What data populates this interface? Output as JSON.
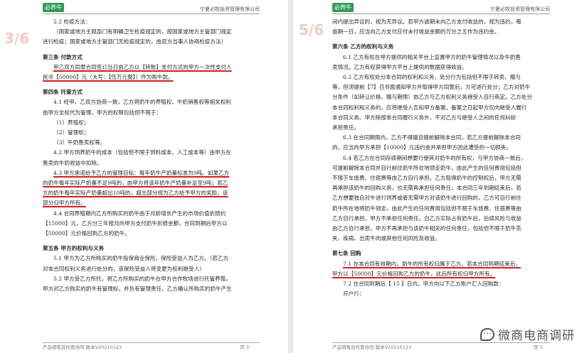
{
  "header": {
    "logo_text": "必养牛",
    "company": "宁夏必牧投资管理有限公司"
  },
  "left_page": {
    "page_marker": "3/6",
    "lines": [
      "2.2 检疫方法：",
      "（国家或地方主观部门有明确卫生检疫规定的，按国家或地方主管部门规定",
      "进行检疫；国家或地方主管部门无检疫规定的，由双方当事人协商检疫方法）",
      "第三条 付款方式",
      "甲乙双方同意合同签订当日由乙方以【转账】支付方式向甲方一次性支付人",
      "民币【50000】元（大写：【伍万元整】）作为购牛款。",
      "第四条 托管方式",
      "4.1 经甲、乙双方协商一致，乙方将奶牛的养殖权、牛奶销售权等相关权利",
      "由甲方全权代为管理，甲方的权限包括但不限于：",
      "（1）养殖权；",
      "（2）管理权；",
      "（3）牛奶售卖权等。",
      "4.2 甲方饲养奶牛的成本（包括但不限于饲料成本、人工成本等）由甲方在",
      "售卖的牛奶收益中扣除。",
      "4.3 甲方承诺给予乙方的管理目标：每年奶牛产奶量标准为9吨。如果乙方",
      "的奶牛每年实际产奶量不足9吨的，由甲方将该年奶牛产奶量补足至9吨；若乙",
      "方的奶牛每年实际产奶量超出10吨的，超出部分视为乙方给予甲方的奖励，该",
      "部分归甲方所有。",
      "4.4 合同养殖期内乙方所购买的奶牛由于月龄增长产生的市场价值折损约",
      "【15000】元，乙方分三年按月向甲方支付奶牛折损金额，合同到期后甲方以",
      "【50000】元价格回购乙方的奶牛。",
      "第五条 甲方的权利与义务",
      "5.1 甲方为乙方所购买的奶牛投保商业保险，保险受益人为乙方。（若乙方",
      "对本合同权利义务进行处分的，该保险受益人将变更为权利继受人）",
      "5.2 甲方受乙方所托，将乙方所购买的奶牛在甲方合作牧场进行托管养殖，",
      "甲方对乙方购买的奶牛有管理权，并负有管理责任，乙方确认所购买的奶牛产生"
    ],
    "footer_left": "产品销售及托管合同 版本V20210123",
    "footer_right": "页 3"
  },
  "right_page": {
    "page_marker": "5/6",
    "lines": [
      "间内提出异议的，视为无异议。若甲方逾期未向乙方支付收益的，视为违约，每",
      "逾期一日，应当向乙方支付应付未付收益金额的万分之五作为违约金。",
      "第六条 乙方的权利与义务",
      "6.1 乙方有权在甲方提供的相关平台上监督甲方的奶牛管理情况以及牛奶售",
      "卖情况。乙方有权获得甲方平台上提供的数据获得收益。",
      "6.2 乙方有权处分本合同的权利和义务，处分行为包括但不限于转卖、赠与",
      "等，但须提前【7】日书面通知甲方并取得甲方同意后，方可进行处分；乙方对奶牛",
      "分条件（如转让价格、赠与期限）由乙方与乙方权利义务继受人自行商定。乙方处分",
      "本合同权利和义务的，应将继受人告知甲方备案。备案之日起甲方仅向继受人履行",
      "本合同义务。甲方除按本合同履行义务外，不对乙方与继受人之间的任何纠纷",
      "承担责任。",
      "6.3 在合同期限内，乙方不得擅自提前解除本合同，若乙方提前解除本合同",
      "的，应当向甲方承担【10000】元违约金并承担甲方因此遭受的一切损失。",
      "6.4 若乙方在合同存续期间想要行使其对奶牛的所有权，与甲方协商一致后，",
      "可提前解除本合同并自行前往奶牛所在地领走奶牛，由此产生的任何费用包括但",
      "不限于车旅费、住宿费等由乙方自行承担。乙方取得奶牛的控制权后，甲方无需",
      "再承担该奶牛的回购义务，也无需再承担任何责任；本合同三年到期结束后，若",
      "乙方想要独自对牛进行饲养或者无需甲方对该奶牛进行回购的，乙方可自行前往",
      "奶牛所在地将奶牛领走，由此产生的任何费用包括但不限于车旅费、住宿费等由",
      "乙方自行承担，甲方不承担任何责任。自乙方实际占有奶牛后，后续风险与收益",
      "由乙方自行承担，甲方不再承担与该奶牛相关的任何责任，包括但不限于奶牛丢",
      "失、疾病、出卖牛肉或其他任何风险及收益。",
      "第七条 回购",
      "7.1 在本合同有效期内，奶牛的所有权归属于乙方。若本合同到期结束后，",
      "甲方以【50000】元价格回购乙方的奶牛，此后所有权归甲方所有。",
      "7.2 在合同到期后【 15 】日内，甲方向以下乙方账户汇入回购款：",
      "开户行："
    ],
    "footer_left": "产品销售及托管合同 版本V20210123",
    "footer_right": "页 5"
  },
  "watermark": "微商电商调研"
}
